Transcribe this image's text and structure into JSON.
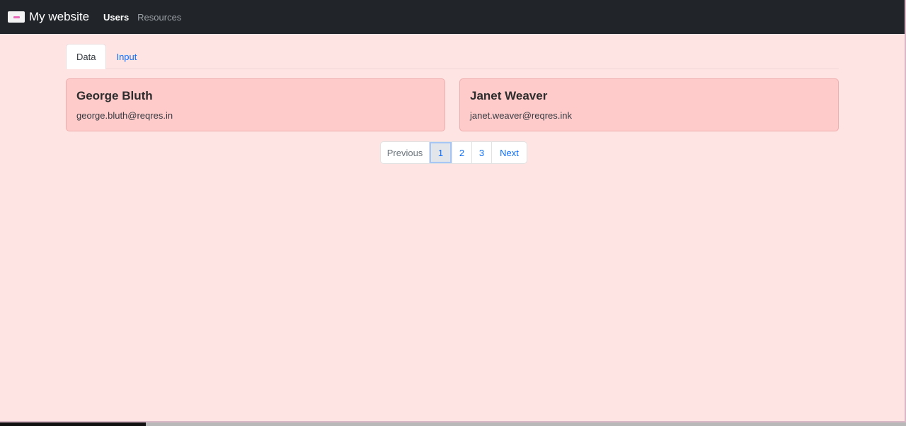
{
  "navbar": {
    "brand": "My website",
    "links": [
      {
        "label": "Users",
        "active": true
      },
      {
        "label": "Resources",
        "active": false
      }
    ]
  },
  "tabs": [
    {
      "label": "Data",
      "active": true
    },
    {
      "label": "Input",
      "active": false
    }
  ],
  "users": [
    {
      "name": "George Bluth",
      "email": "george.bluth@reqres.in"
    },
    {
      "name": "Janet Weaver",
      "email": "janet.weaver@reqres.ink"
    }
  ],
  "pagination": {
    "previous": "Previous",
    "pages": [
      "1",
      "2",
      "3"
    ],
    "current": "1",
    "next": "Next"
  },
  "colors": {
    "navbar_bg": "#212529",
    "page_bg": "#ffe4e4",
    "card_bg": "#ffcaca",
    "link": "#0d6efd"
  }
}
